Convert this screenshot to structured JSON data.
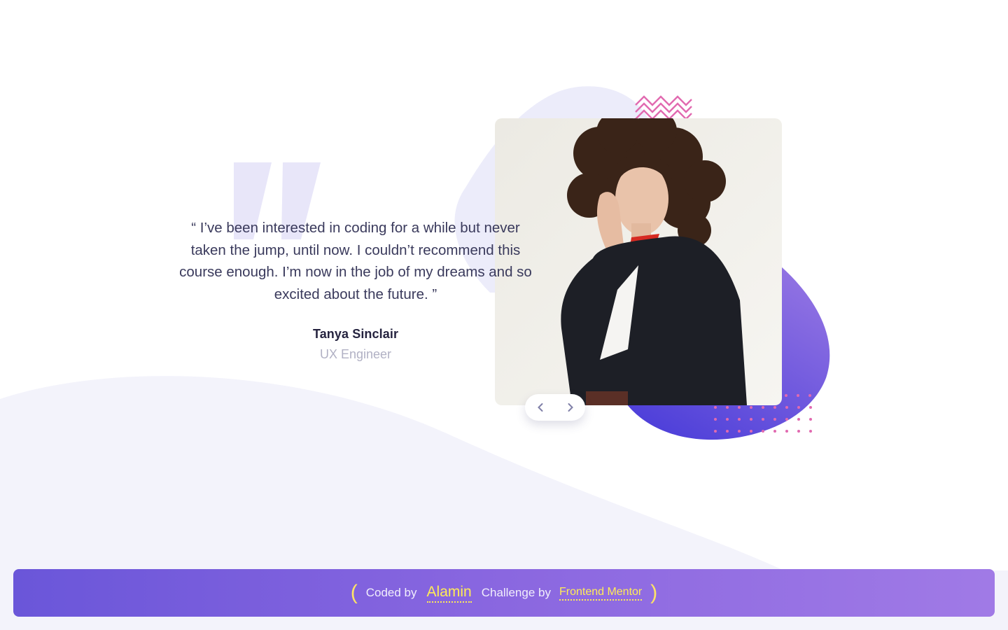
{
  "testimonial": {
    "quote": "“ I’ve been interested in coding for a while but never taken the jump, until now. I couldn’t recommend this course enough. I’m now in the job of my dreams and so excited about the future. ”",
    "name": "Tanya Sinclair",
    "role": "UX Engineer"
  },
  "slider": {
    "prev_icon": "chevron-left-icon",
    "next_icon": "chevron-right-icon"
  },
  "footer": {
    "open_paren": "(",
    "coded_by_label": "Coded by",
    "author_link": "Alamin",
    "challenge_by_label": "Challenge by",
    "challenge_link": "Frontend Mentor",
    "close_paren": ")"
  },
  "colors": {
    "accent_purple": "#6a56d9",
    "dark_text": "#25233f",
    "muted_text": "#b1b1c4",
    "link_yellow": "#ffec57",
    "pattern_pink": "#e16ab0"
  }
}
